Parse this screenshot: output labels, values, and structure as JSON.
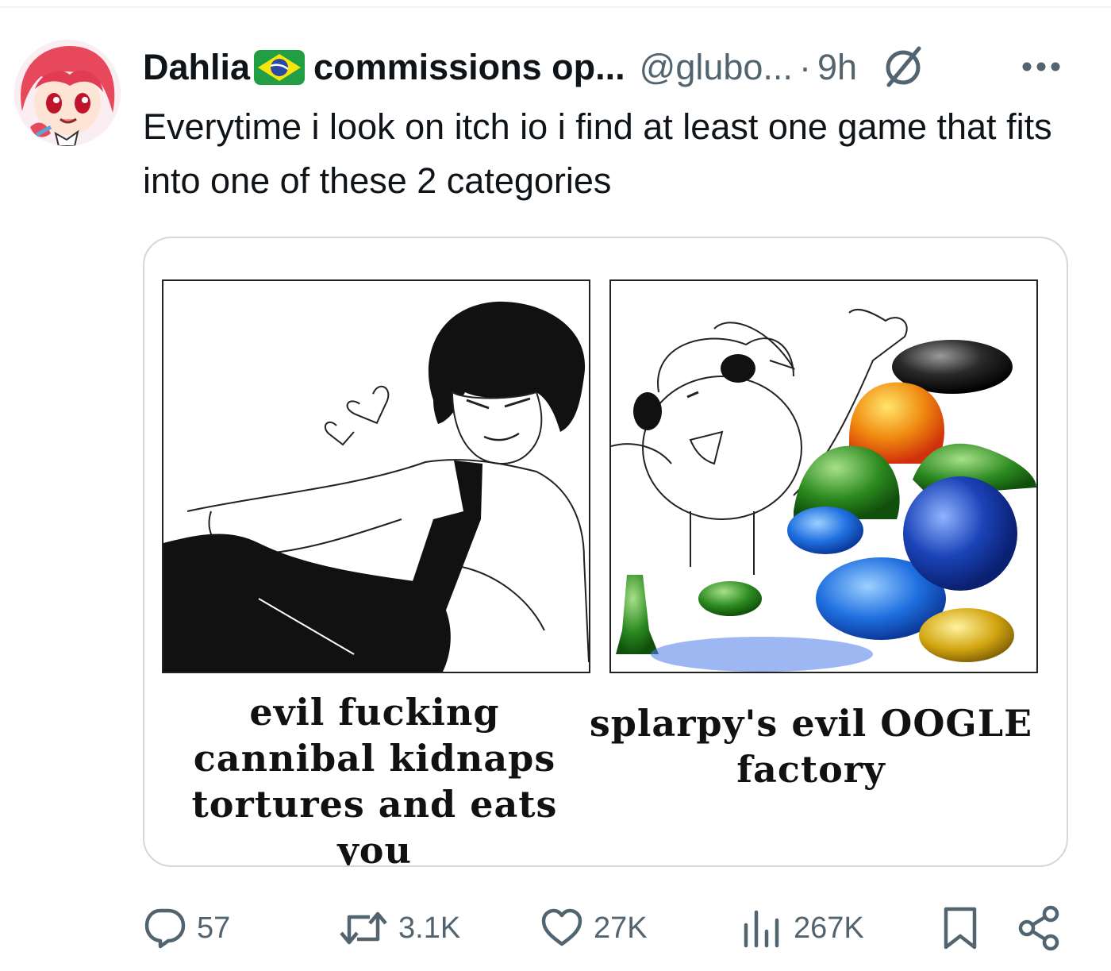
{
  "tweet": {
    "display_name": "Dahlia",
    "name_suffix": "commissions op...",
    "handle": "@glubo...",
    "separator": "·",
    "time": "9h",
    "text": "Everytime i look on itch io i find at least one game that fits into one of these 2 categories"
  },
  "media": {
    "left_caption": "evil fucking cannibal kidnaps tortures and eats you",
    "right_caption": "splarpy's evil OOGLE factory"
  },
  "actions": {
    "replies": "57",
    "retweets": "3.1K",
    "likes": "27K",
    "views": "267K"
  },
  "icons": {
    "flag": "brazil-flag-icon",
    "verified": "slashed-circle-icon",
    "more": "more-dots-icon",
    "reply": "reply-bubble-icon",
    "retweet": "retweet-icon",
    "like": "heart-icon",
    "views": "views-chart-icon",
    "bookmark": "bookmark-icon",
    "share": "share-icon"
  },
  "colors": {
    "text_primary": "#0f1419",
    "text_secondary": "#536471",
    "border": "#cfd9de"
  }
}
